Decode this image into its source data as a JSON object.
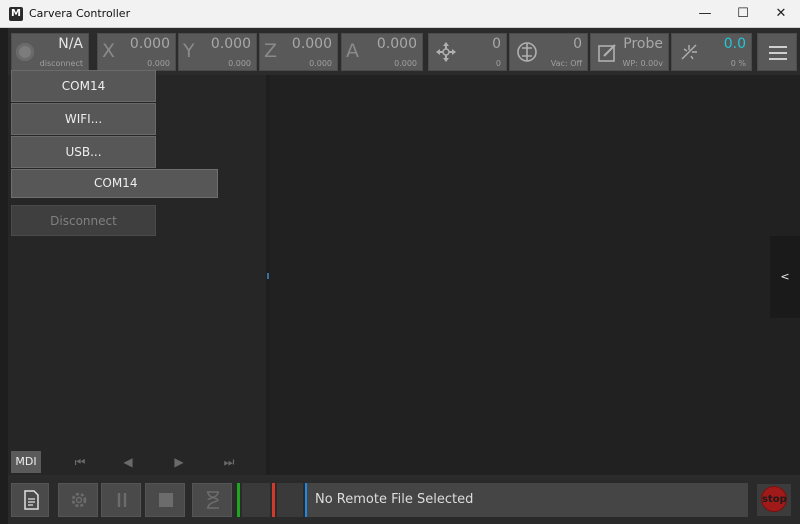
{
  "window": {
    "title": "Carvera Controller",
    "logo_letter": "M",
    "minimize": "—",
    "maximize": "☐",
    "close": "✕"
  },
  "connection": {
    "status": "N/A",
    "substatus": "disconnect"
  },
  "dro": {
    "x": {
      "axis": "X",
      "value": "0.000",
      "sub": "0.000"
    },
    "y": {
      "axis": "Y",
      "value": "0.000",
      "sub": "0.000"
    },
    "z": {
      "axis": "Z",
      "value": "0.000",
      "sub": "0.000"
    },
    "a": {
      "axis": "A",
      "value": "0.000",
      "sub": "0.000"
    },
    "feed": {
      "value": "0",
      "sub": "0"
    },
    "spindle": {
      "value": "0",
      "sub": "Vac: Off"
    },
    "probe": {
      "value": "Probe",
      "sub": "WP: 0.00v"
    },
    "laser": {
      "value": "0.0",
      "sub": "0 %",
      "value_color": "#22c7d6"
    }
  },
  "menu": {
    "items": [
      "COM14",
      "WIFI...",
      "USB..."
    ],
    "submenu_item": "COM14",
    "disconnect": "Disconnect"
  },
  "left_nav": {
    "mdi": "MDI",
    "first": "⏮",
    "prev": "◀",
    "next": "▶",
    "last": "⏭"
  },
  "right_panel": {
    "collapse": "<"
  },
  "bottom": {
    "status": "No Remote File Selected",
    "stop": "stop"
  },
  "colors": {
    "green_bar": "#1fa51f",
    "red_bar": "#cf3b2b",
    "blue_bar": "#1e88e5"
  }
}
